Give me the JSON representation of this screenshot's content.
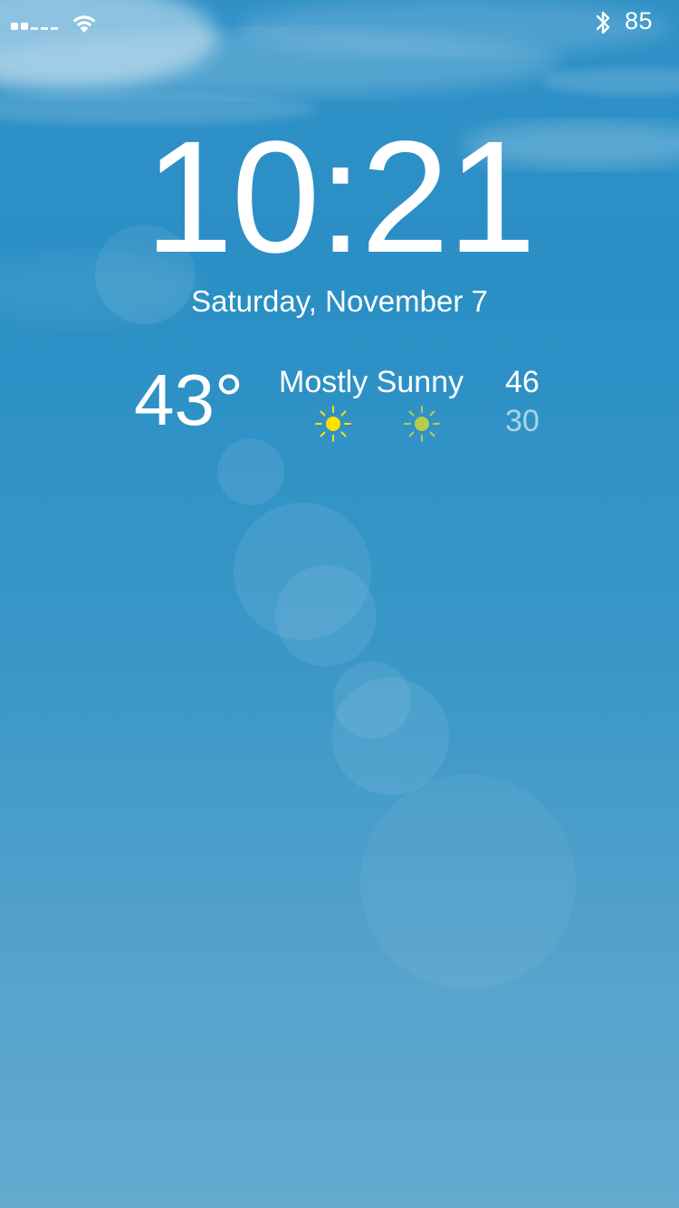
{
  "status_bar": {
    "signal_icon": "signal-icon",
    "wifi_icon": "wifi-icon",
    "bluetooth_icon": "bluetooth-icon",
    "battery_level": "85"
  },
  "lock_screen": {
    "time": "10:21",
    "date": "Saturday, November 7"
  },
  "weather": {
    "current_temp": "43°",
    "condition": "Mostly Sunny",
    "high": "46",
    "low": "30",
    "icons": [
      "sun-icon",
      "sun-icon"
    ],
    "colors": {
      "sun_primary": "#ffe000",
      "sun_secondary": "#b8cc4a"
    }
  }
}
